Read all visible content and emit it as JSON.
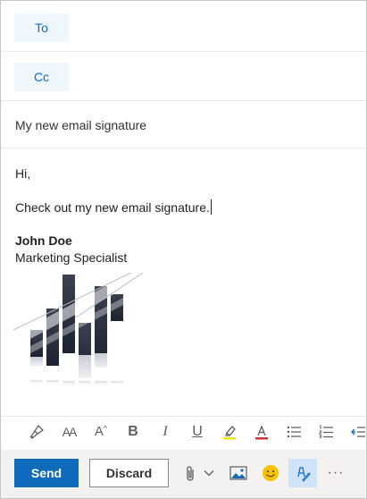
{
  "recipients": {
    "to_label": "To",
    "cc_label": "Cc"
  },
  "subject": {
    "text": "My new email signature"
  },
  "body": {
    "greeting": "Hi,",
    "text": "Check out my new email signature."
  },
  "signature": {
    "name": "John Doe",
    "title": "Marketing Specialist"
  },
  "format_toolbar": {
    "items": [
      "format-painter",
      "font-size",
      "superscript-size",
      "bold",
      "italic",
      "underline",
      "highlight",
      "font-color",
      "bullets",
      "numbering",
      "decrease-indent"
    ],
    "bold_glyph": "B",
    "italic_glyph": "I",
    "underline_glyph": "U",
    "font_size_glyph": "AA",
    "grow_glyph": "A",
    "font_color_glyph": "A"
  },
  "actions": {
    "send_label": "Send",
    "discard_label": "Discard",
    "more_label": "···"
  },
  "colors": {
    "accent": "#0f6cbd",
    "recipient_button_bg": "#eff6fc",
    "action_bar_bg": "#f3f2f1",
    "highlight_yellow": "#f2e600",
    "font_color_red": "#d13438",
    "emoji_yellow": "#f7c300"
  }
}
